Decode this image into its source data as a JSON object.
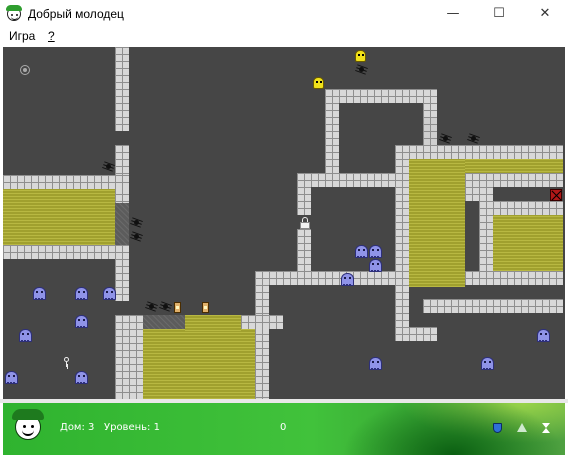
{
  "window": {
    "title": "Добрый молодец",
    "minimize_glyph": "—",
    "maximize_glyph": "☐",
    "close_glyph": "✕"
  },
  "menu": {
    "game": "Игра",
    "help": "?"
  },
  "status": {
    "home_label": "Дом: 3",
    "level_label": "Уровень: 1",
    "score": "0",
    "icons": [
      "shield-icon",
      "triangle-icon",
      "hourglass-icon"
    ]
  },
  "colors": {
    "board": "#464646",
    "wall": "#d8d8d8",
    "yard": "#a8a834",
    "enemy_ghost": "#8f93e8",
    "player": "#f1e21a",
    "status_bar": "#2fb32f"
  }
}
